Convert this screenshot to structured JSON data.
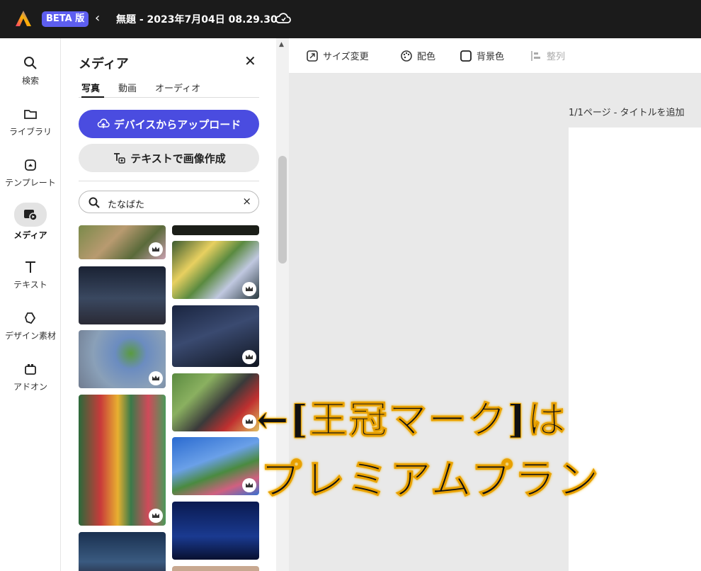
{
  "app": {
    "beta_badge": "BETA 版",
    "back_glyph": "‹",
    "document_title": "無題 - 2023年7月04日 08.29.30",
    "cloud_icon": "cloud-sync-icon"
  },
  "rail": {
    "items": [
      {
        "label": "検索",
        "icon": "search-icon"
      },
      {
        "label": "ライブラリ",
        "icon": "folder-icon"
      },
      {
        "label": "テンプレート",
        "icon": "template-icon"
      },
      {
        "label": "メディア",
        "icon": "media-icon",
        "active": true
      },
      {
        "label": "テキスト",
        "icon": "text-icon"
      },
      {
        "label": "デザイン素材",
        "icon": "shapes-icon"
      },
      {
        "label": "アドオン",
        "icon": "addon-icon"
      }
    ]
  },
  "panel": {
    "title": "メディア",
    "close_glyph": "✕",
    "tabs": [
      "写真",
      "動画",
      "オーディオ"
    ],
    "upload_button": "デバイスからアップロード",
    "text_to_image_button": "テキストで画像作成",
    "search": {
      "value": "たなばた",
      "clear_glyph": "×"
    }
  },
  "toolbar": {
    "resize": "サイズ変更",
    "palette": "配色",
    "background_color": "背景色",
    "align": "整列"
  },
  "canvas": {
    "page_label": "1/1ページ - タイトルを追加"
  },
  "annotation": {
    "line1": "←[王冠マーク]は",
    "line2": "プレミアムプラン"
  },
  "colors": {
    "topbar": "#1b1b1b",
    "accent": "#4a4ce0",
    "annotation_outline": "#f2b300"
  }
}
